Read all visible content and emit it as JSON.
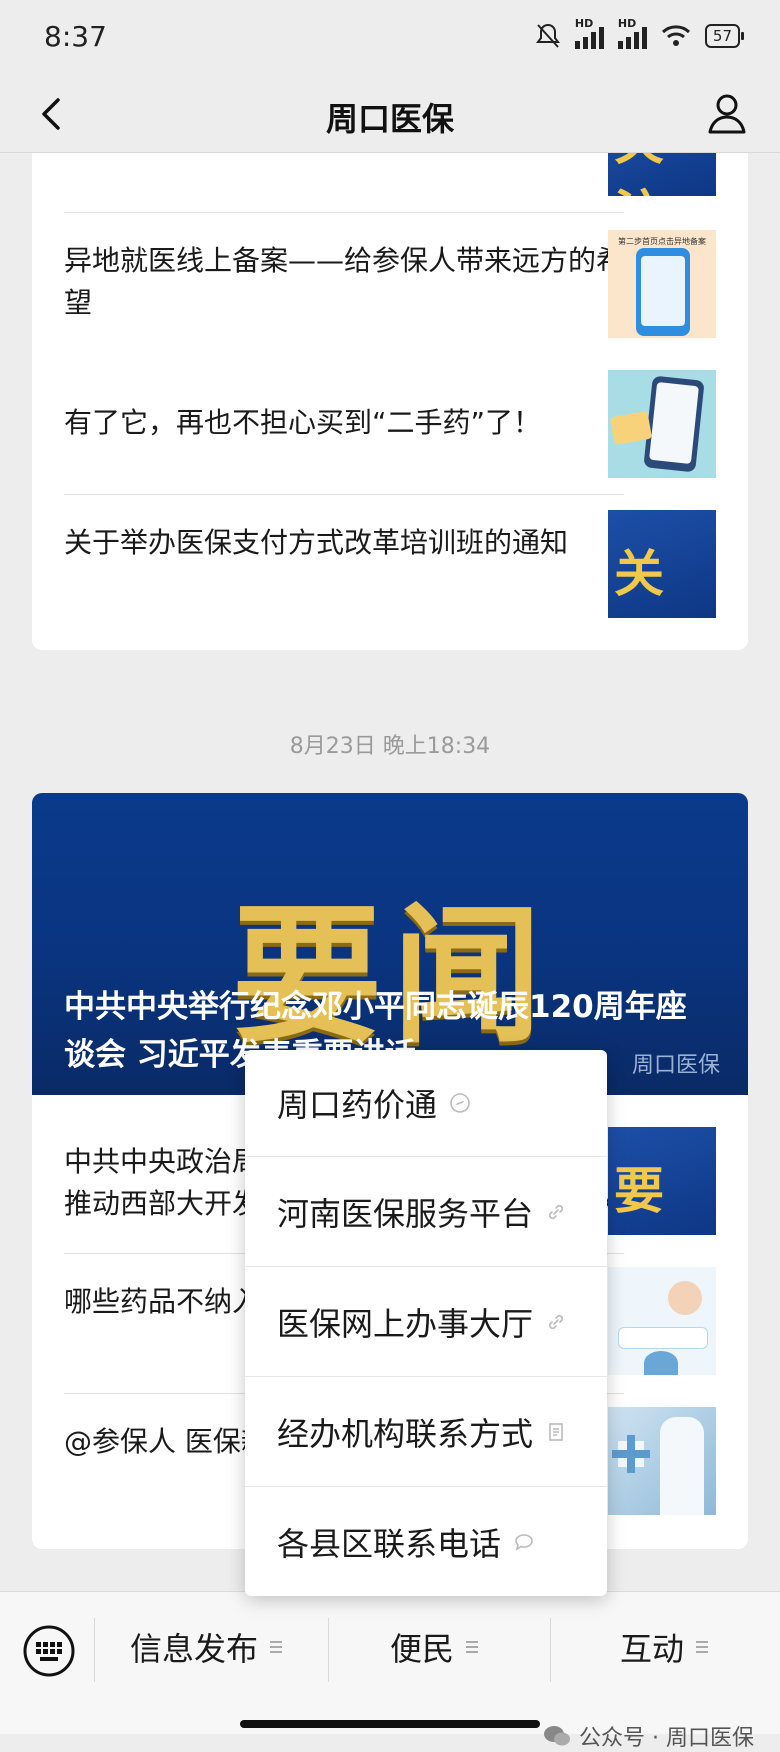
{
  "status": {
    "time": "8:37",
    "signal1": "HD",
    "signal2": "HD",
    "battery": "57"
  },
  "nav": {
    "title": "周口医保"
  },
  "card1": {
    "items": [
      {
        "title": "异地就医线上备案——给参保人带来远方的希望"
      },
      {
        "title": "有了它，再也不担心买到“二手药”了！"
      },
      {
        "title": "关于举办医保支付方式改革培训班的通知"
      }
    ],
    "thumb_labels": {
      "focus": "关注",
      "thumb_step": "第二步首页点击异地备案"
    }
  },
  "date_label": "8月23日 晚上18:34",
  "card2": {
    "hero": {
      "big_text": "要闻",
      "title": "中共中央举行纪念邓小平同志诞辰120周年座谈会 习近平发表重要讲话",
      "source": "周口医保"
    },
    "items": [
      {
        "title": "中共中央政治局召开会议 审议《关于进一步推动西部大开发形成新格局的若干政策措施》"
      },
      {
        "title": "哪些药品不纳入医保支付范围？一文了解→"
      },
      {
        "title": "@参保人 医保新规出台 对你有什么影响？"
      }
    ],
    "thumb_news": "要闻"
  },
  "popup": {
    "items": [
      {
        "label": "周口药价通",
        "icon": "miniprogram-icon"
      },
      {
        "label": "河南医保服务平台",
        "icon": "link-icon"
      },
      {
        "label": "医保网上办事大厅",
        "icon": "link-icon"
      },
      {
        "label": "经办机构联系方式",
        "icon": "document-icon"
      },
      {
        "label": "各县区联系电话",
        "icon": "chat-bubble-icon"
      }
    ]
  },
  "bottom_menu": {
    "items": [
      {
        "label": "信息发布"
      },
      {
        "label": "便民"
      },
      {
        "label": "互动"
      }
    ],
    "watermark": "公众号 · 周口医保"
  }
}
